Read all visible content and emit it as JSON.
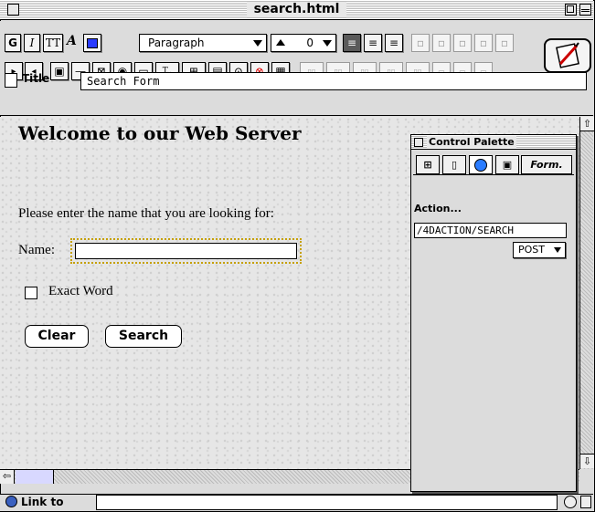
{
  "window": {
    "title": "search.html"
  },
  "toolbar": {
    "bold_label": "G",
    "italic_label": "I",
    "tt_label": "TT",
    "font_label": "A",
    "paragraph_style": "Paragraph",
    "font_size": "0"
  },
  "document": {
    "title_label": "Title",
    "title_value": "Search Form",
    "heading": "Welcome to our Web Server",
    "prompt": "Please enter the name that you are looking for:",
    "name_label": "Name:",
    "name_value": "",
    "exact_word_label": "Exact Word",
    "clear_label": "Clear",
    "search_label": "Search"
  },
  "palette": {
    "title": "Control Palette",
    "tab_form_label": "Form.",
    "action_label": "Action...",
    "action_value": "/4DACTION/SEARCH",
    "method": "POST"
  },
  "status": {
    "link_to_label": "Link to",
    "link_value": ""
  }
}
